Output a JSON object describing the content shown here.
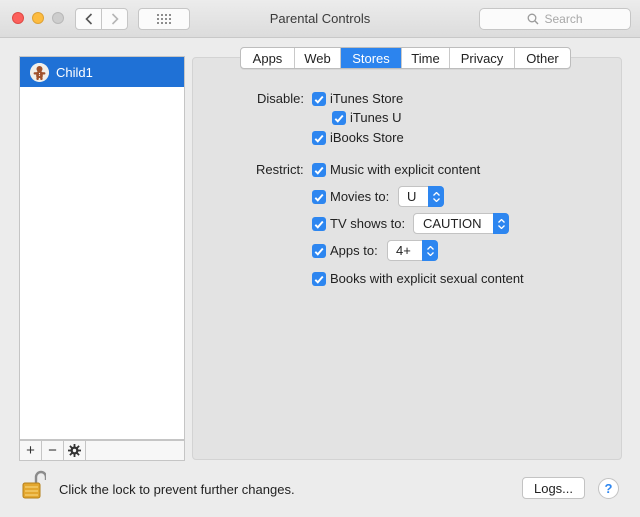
{
  "window": {
    "title": "Parental Controls"
  },
  "toolbar": {
    "search_placeholder": "Search",
    "search_icon": "magnifier-icon",
    "grid_icon": "show-all-grid-icon"
  },
  "users": [
    {
      "name": "Child1",
      "selected": true
    }
  ],
  "user_toolbar": {
    "add": "+",
    "remove": "−",
    "gear_icon": "gear-icon"
  },
  "tabs": [
    {
      "label": "Apps",
      "active": false
    },
    {
      "label": "Web",
      "active": false
    },
    {
      "label": "Stores",
      "active": true
    },
    {
      "label": "Time",
      "active": false
    },
    {
      "label": "Privacy",
      "active": false
    },
    {
      "label": "Other",
      "active": false
    }
  ],
  "stores": {
    "disable_label": "Disable:",
    "disable": {
      "itunes_store": {
        "label": "iTunes Store",
        "checked": true
      },
      "itunes_u": {
        "label": "iTunes U",
        "checked": true
      },
      "ibooks_store": {
        "label": "iBooks Store",
        "checked": true
      }
    },
    "restrict_label": "Restrict:",
    "restrict": {
      "music": {
        "label": "Music with explicit content",
        "checked": true
      },
      "movies": {
        "label": "Movies to:",
        "checked": true,
        "value": "U"
      },
      "tv": {
        "label": "TV shows to:",
        "checked": true,
        "value": "CAUTION"
      },
      "apps": {
        "label": "Apps to:",
        "checked": true,
        "value": "4+"
      },
      "books": {
        "label": "Books with explicit sexual content",
        "checked": true
      }
    }
  },
  "footer": {
    "lock_text": "Click the lock to prevent further changes.",
    "logs_button": "Logs...",
    "help_button": "?"
  },
  "colors": {
    "accent": "#2d86f0",
    "selection": "#1f71d6"
  }
}
